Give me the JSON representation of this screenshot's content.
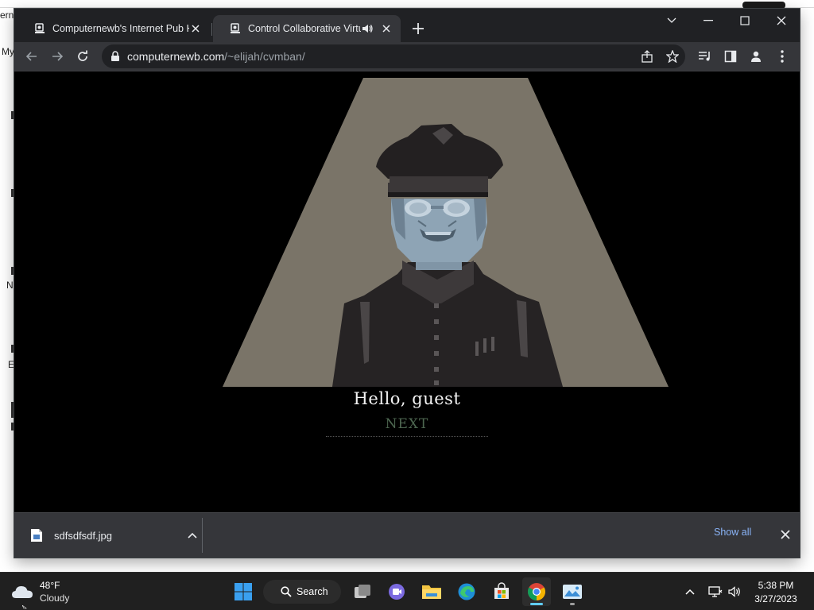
{
  "desktop": {
    "fragments": [
      "ern",
      "My",
      "N",
      "E"
    ]
  },
  "tabs": [
    {
      "title": "Computernewb's Internet Pub Hu",
      "favicon": "site-logo-icon",
      "active": false
    },
    {
      "title": "Control Collaborative Virtual",
      "favicon": "site-logo-icon",
      "active": true,
      "audio": "speaker-icon"
    }
  ],
  "address_bar": {
    "host": "computernewb.com",
    "path": "/~elijah/cvmban/"
  },
  "page": {
    "greeting": "Hello, guest",
    "next_label": "NEXT"
  },
  "download_bar": {
    "file_name": "sdfsdfsdf.jpg",
    "show_all_label": "Show all"
  },
  "taskbar": {
    "weather": {
      "temp": "48°F",
      "condition": "Cloudy"
    },
    "search_label": "Search",
    "time": "5:38 PM",
    "date": "3/27/2023"
  },
  "colors": {
    "spotlight": "#7a7468",
    "page_background": "#000000",
    "next_text": "#4d6650",
    "link_blue": "#8ab4f8"
  }
}
